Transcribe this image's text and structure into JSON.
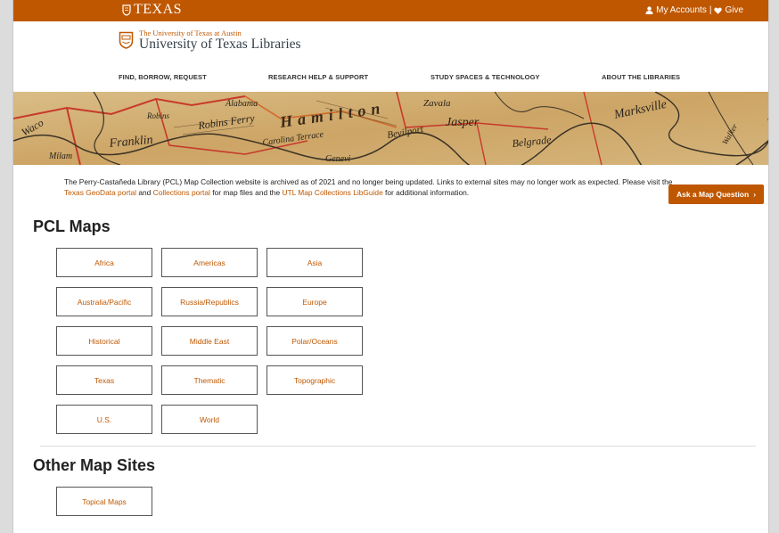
{
  "brand": {
    "wordmark": "TEXAS"
  },
  "account": {
    "my_accounts": "My Accounts",
    "separator": "|",
    "give": "Give"
  },
  "logo": {
    "line1": "The University of Texas at Austin",
    "line2": "University of Texas Libraries"
  },
  "nav": [
    {
      "label": "FIND, BORROW, REQUEST"
    },
    {
      "label": "RESEARCH HELP & SUPPORT"
    },
    {
      "label": "STUDY SPACES & TECHNOLOGY"
    },
    {
      "label": "ABOUT THE LIBRARIES"
    }
  ],
  "banner_map_labels": [
    "Waco",
    "Milam",
    "Franklin",
    "Robins Ferry",
    "Alabama",
    "Carolina Terrace",
    "Hamilton",
    "Genevi",
    "Zavala",
    "Jasper",
    "Bevilport",
    "Belgrade",
    "Marksville",
    "Robins",
    "Walker"
  ],
  "notice": {
    "text1": "The Perry-Castañeda Library (PCL) Map Collection website is archived as of 2021 and no longer being updated. Links to external sites may no longer work as expected. Please visit the ",
    "link1": "Texas GeoData portal",
    "text2": " and ",
    "link2": "Collections portal",
    "text3": " for map files and the ",
    "link3": "UTL Map Collections LibGuide",
    "text4": " for additional information."
  },
  "ask_button": {
    "label": "Ask a Map Question",
    "chevron": "›"
  },
  "pcl_maps": {
    "heading": "PCL Maps",
    "buttons": [
      "Africa",
      "Americas",
      "Asia",
      "Australia/Pacific",
      "Russia/Republics",
      "Europe",
      "Historical",
      "Middle East",
      "Polar/Oceans",
      "Texas",
      "Thematic",
      "Topographic",
      "U.S.",
      "World"
    ]
  },
  "other_sites": {
    "heading": "Other Map Sites",
    "buttons": [
      "Topical Maps"
    ]
  },
  "colors": {
    "accent": "#bf5700",
    "text": "#222222",
    "logo_text": "#333f48"
  },
  "icons": {
    "shield": "ut-shield-icon",
    "user": "user-icon",
    "heart": "heart-icon"
  }
}
